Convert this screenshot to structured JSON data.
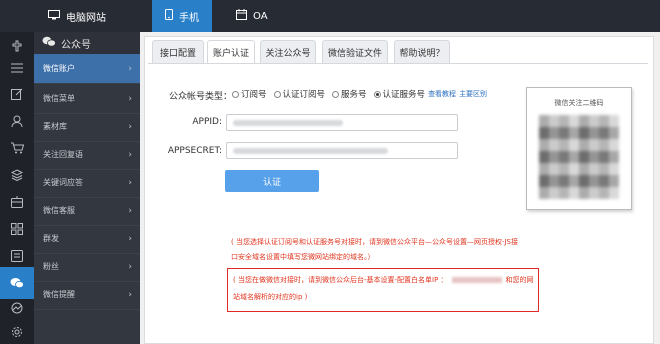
{
  "topbar": {
    "tabs": [
      {
        "label": "电脑网站",
        "icon": "monitor-icon"
      },
      {
        "label": "手机",
        "icon": "phone-icon",
        "active": true
      },
      {
        "label": "OA",
        "icon": "calendar-icon"
      }
    ]
  },
  "sidebar_icons": [
    "puzzle-icon",
    "list-icon",
    "edit-icon",
    "user-icon",
    "cart-icon",
    "stack-icon",
    "box-icon",
    "grid-icon",
    "ticket-icon",
    "wechat-icon",
    "network-icon",
    "gear-icon"
  ],
  "menu": {
    "header": "公众号",
    "items": [
      {
        "label": "微信账户",
        "active": true
      },
      {
        "label": "微信菜单"
      },
      {
        "label": "素材库"
      },
      {
        "label": "关注回复语"
      },
      {
        "label": "关键词应答"
      },
      {
        "label": "微信客服"
      },
      {
        "label": "群发"
      },
      {
        "label": "粉丝"
      },
      {
        "label": "微信提醒"
      }
    ]
  },
  "tabs": [
    "接口配置",
    "账户认证",
    "关注公众号",
    "微信验证文件",
    "帮助说明？"
  ],
  "active_tab": "账户认证",
  "form": {
    "account_type_label": "公众帐号类型：",
    "radio_options": [
      "订阅号",
      "认证订阅号",
      "服务号",
      "认证服务号"
    ],
    "selected_option": "认证服务号",
    "links": [
      "查看教程",
      "主要区别"
    ],
    "appid_label": "APPID:",
    "appsecret_label": "APPSECRET:",
    "submit_label": "认证"
  },
  "qr": {
    "title": "微信关注二维码"
  },
  "notes": {
    "line1": "( 当您选择认证订阅号和认证服务号对接时，请到微信公众平台—公众号设置—网页授权-JS接",
    "line2": "口安全域名设置中填写您微网站绑定的域名。）",
    "line3a": "( 当您在做微信对接时，请到微信公众后台-基本设置-配置白名单IP ：",
    "line3b": "和您的网",
    "line4": "站域名解析的对应的ip )"
  },
  "colors": {
    "accent": "#2a7fc9",
    "button": "#57a0ea",
    "warning": "#e0341e"
  }
}
